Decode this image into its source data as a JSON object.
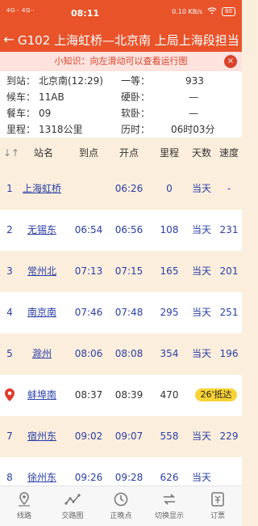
{
  "status_bar": {
    "network": "4G·· 4G··",
    "time": "08:11",
    "speed": "0.10 KB/s",
    "battery": "60"
  },
  "header": {
    "back": "←",
    "title": "G102 上海虹桥—北京南  上局上海段担当"
  },
  "tip": {
    "text": "小知识：向左滑动可以查看运行图",
    "close": "×"
  },
  "info": {
    "arrive_label": "到站：",
    "arrive_value": "北京南(12:29)",
    "first_label": "一等：",
    "first_value": "933",
    "waiting_label": "候车：",
    "waiting_value": "11AB",
    "hard_label": "硬卧：",
    "hard_value": "—",
    "dining_label": "餐车：",
    "dining_value": "09",
    "soft_label": "软卧：",
    "soft_value": "—",
    "distance_label": "里程：",
    "distance_value": "1318公里",
    "duration_label": "历时：",
    "duration_value": "06时03分"
  },
  "table": {
    "headers": {
      "sort": "↓↑",
      "station": "站名",
      "arrive": "到点",
      "depart": "开点",
      "distance": "里程",
      "days": "天数",
      "speed": "速度"
    },
    "rows": [
      {
        "no": "1",
        "station": "上海虹桥",
        "arrive": "",
        "depart": "06:26",
        "distance": "0",
        "days": "当天",
        "speed": "-"
      },
      {
        "no": "2",
        "station": "无锡东",
        "arrive": "06:54",
        "depart": "06:56",
        "distance": "108",
        "days": "当天",
        "speed": "231"
      },
      {
        "no": "3",
        "station": "常州北",
        "arrive": "07:13",
        "depart": "07:15",
        "distance": "165",
        "days": "当天",
        "speed": "201"
      },
      {
        "no": "4",
        "station": "南京南",
        "arrive": "07:46",
        "depart": "07:48",
        "distance": "295",
        "days": "当天",
        "speed": "251"
      },
      {
        "no": "5",
        "station": "滁州",
        "arrive": "08:06",
        "depart": "08:08",
        "distance": "354",
        "days": "当天",
        "speed": "196"
      },
      {
        "no": "",
        "station": "蚌埠南",
        "arrive": "08:37",
        "depart": "08:39",
        "distance": "470",
        "days": "26'抵达",
        "speed": ""
      },
      {
        "no": "7",
        "station": "宿州东",
        "arrive": "09:02",
        "depart": "09:07",
        "distance": "558",
        "days": "当天",
        "speed": "229"
      },
      {
        "no": "8",
        "station": "徐州东",
        "arrive": "09:26",
        "depart": "09:28",
        "distance": "626",
        "days": "当天",
        "speed": ""
      }
    ]
  },
  "tabs": [
    {
      "label": "线路",
      "icon": "route-icon"
    },
    {
      "label": "交路图",
      "icon": "chart-icon"
    },
    {
      "label": "正晚点",
      "icon": "clock-icon"
    },
    {
      "label": "切换显示",
      "icon": "switch-icon"
    },
    {
      "label": "订票",
      "icon": "ticket-icon"
    }
  ]
}
